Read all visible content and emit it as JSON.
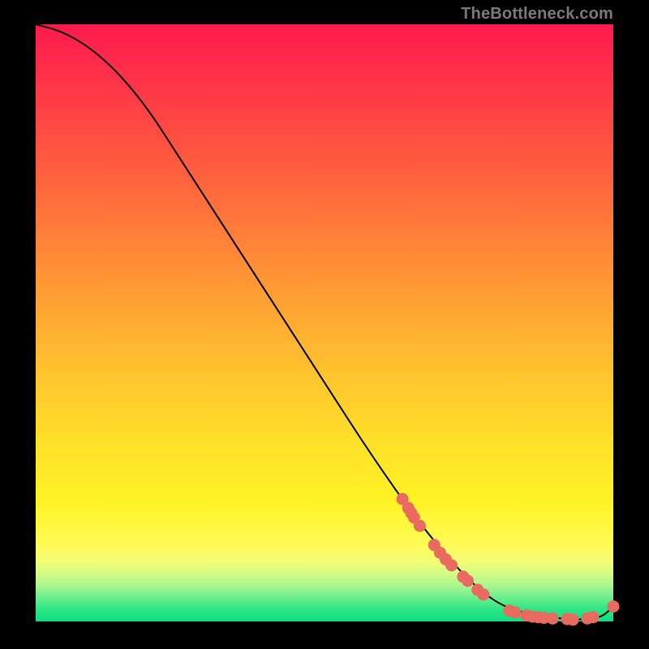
{
  "watermark": "TheBottleneck.com",
  "colors": {
    "background": "#000000",
    "gradient_top": "#ff1a4d",
    "gradient_mid": "#ffe028",
    "gradient_bottom": "#0adf80",
    "curve": "#000000",
    "marker_fill": "#e96a5f",
    "marker_stroke": "#c94f44"
  },
  "chart_data": {
    "type": "line",
    "title": "",
    "xlabel": "",
    "ylabel": "",
    "xlim": [
      0,
      100
    ],
    "ylim": [
      0,
      100
    ],
    "curve": {
      "x": [
        0,
        4,
        8,
        12,
        16,
        20,
        24,
        30,
        36,
        42,
        50,
        58,
        66,
        72,
        76,
        80,
        84,
        88,
        92,
        95,
        98,
        100
      ],
      "y": [
        100,
        99,
        97,
        94,
        90,
        85,
        79,
        70,
        61,
        52,
        40,
        28,
        17,
        10,
        6,
        3,
        1.5,
        0.8,
        0.4,
        0.3,
        0.7,
        2.5
      ]
    },
    "markers": [
      {
        "x": 63.5,
        "y": 20.5
      },
      {
        "x": 64.5,
        "y": 19.0
      },
      {
        "x": 65.0,
        "y": 18.2
      },
      {
        "x": 65.5,
        "y": 17.4
      },
      {
        "x": 66.5,
        "y": 16.0
      },
      {
        "x": 69.0,
        "y": 12.8
      },
      {
        "x": 70.0,
        "y": 11.5
      },
      {
        "x": 71.0,
        "y": 10.4
      },
      {
        "x": 72.0,
        "y": 9.4
      },
      {
        "x": 74.0,
        "y": 7.5
      },
      {
        "x": 74.8,
        "y": 6.8
      },
      {
        "x": 76.5,
        "y": 5.3
      },
      {
        "x": 77.5,
        "y": 4.5
      },
      {
        "x": 82.0,
        "y": 1.8
      },
      {
        "x": 83.0,
        "y": 1.5
      },
      {
        "x": 85.0,
        "y": 1.0
      },
      {
        "x": 86.0,
        "y": 0.8
      },
      {
        "x": 87.0,
        "y": 0.7
      },
      {
        "x": 88.0,
        "y": 0.6
      },
      {
        "x": 89.5,
        "y": 0.5
      },
      {
        "x": 92.0,
        "y": 0.4
      },
      {
        "x": 93.0,
        "y": 0.3
      },
      {
        "x": 95.5,
        "y": 0.5
      },
      {
        "x": 96.5,
        "y": 0.7
      },
      {
        "x": 100.0,
        "y": 2.5
      }
    ]
  }
}
